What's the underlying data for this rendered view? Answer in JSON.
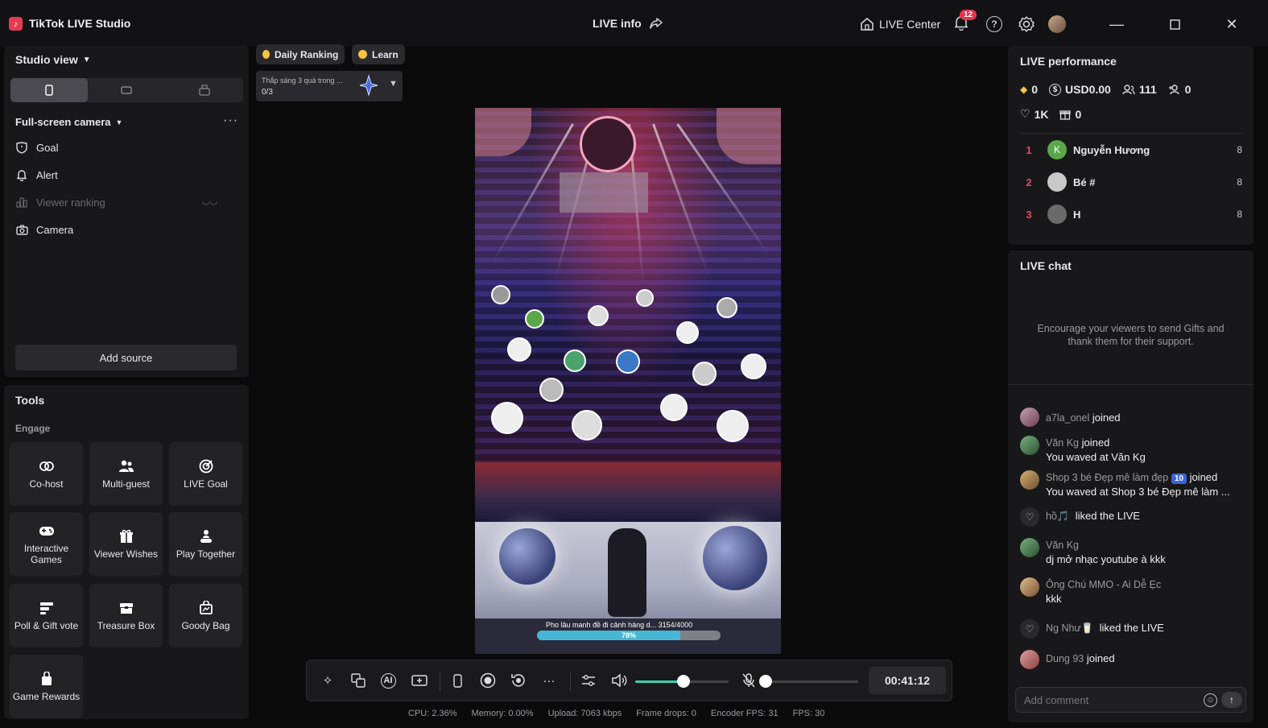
{
  "app": {
    "title": "TikTok LIVE Studio",
    "live_info": "LIVE info",
    "live_center": "LIVE Center",
    "notifications": "12"
  },
  "left": {
    "studio_view": "Studio view",
    "scene": "Full-screen camera",
    "sources": [
      {
        "label": "Goal",
        "icon": "goal-shield-icon",
        "enabled": true
      },
      {
        "label": "Alert",
        "icon": "bell-icon",
        "enabled": true
      },
      {
        "label": "Viewer ranking",
        "icon": "ranking-icon",
        "enabled": false
      },
      {
        "label": "Camera",
        "icon": "camera-icon",
        "enabled": true
      }
    ],
    "add_source": "Add source"
  },
  "tools": {
    "title": "Tools",
    "section": "Engage",
    "items": [
      {
        "label": "Co-host",
        "icon": "link-icon"
      },
      {
        "label": "Multi-guest",
        "icon": "users-icon"
      },
      {
        "label": "LIVE Goal",
        "icon": "target-icon"
      },
      {
        "label": "Interactive Games",
        "icon": "gamepad-icon"
      },
      {
        "label": "Viewer Wishes",
        "icon": "gift-wish-icon"
      },
      {
        "label": "Play Together",
        "icon": "play-together-icon"
      },
      {
        "label": "Poll & Gift vote",
        "icon": "poll-icon"
      },
      {
        "label": "Treasure Box",
        "icon": "treasure-box-icon"
      },
      {
        "label": "Goody Bag",
        "icon": "goody-bag-icon"
      },
      {
        "label": "Game Rewards",
        "icon": "game-rewards-icon"
      }
    ]
  },
  "center": {
    "daily_ranking": "Daily Ranking",
    "learn": "Learn",
    "task_text": "Thắp sáng 3 quà trong ...",
    "task_progress": "0/3",
    "goal_bar_text": "Pho lâu manh đề đi cảnh hàng d... 3154/4000",
    "goal_bar_percent": "78%",
    "goal_bar_fill": 0.78,
    "timer": "00:41:12",
    "volume_level": 0.52,
    "mic_level": 0.0
  },
  "stats": {
    "cpu": "CPU:  2.36%",
    "memory": "Memory:  0.00%",
    "upload": "Upload:  7063 kbps",
    "frame_drops": "Frame drops:  0",
    "encoder_fps": "Encoder FPS:  31",
    "fps": "FPS:  30"
  },
  "performance": {
    "title": "LIVE performance",
    "diamonds": "0",
    "usd": "USD0.00",
    "viewers": "111",
    "new_followers": "0",
    "likes": "1K",
    "gifts": "0",
    "ranking": [
      {
        "rank": "1",
        "name": "Nguyễn Hương",
        "score": "8",
        "initial": "K",
        "color": "#5aa84a"
      },
      {
        "rank": "2",
        "name": "Bé #",
        "score": "8",
        "initial": "",
        "color": "#c8c8c8"
      },
      {
        "rank": "3",
        "name": "H",
        "score": "8",
        "initial": "",
        "color": "#6a6a6a"
      }
    ]
  },
  "chat": {
    "title": "LIVE chat",
    "encourage": "Encourage your viewers to send Gifts and thank them for their support.",
    "messages": [
      {
        "user": "a7la_onel",
        "action": "joined",
        "extra": ""
      },
      {
        "user": "Văn Kg",
        "action": "joined",
        "extra": "You waved at Văn Kg"
      },
      {
        "user": "Shop 3 bé Đẹp mê làm đẹp",
        "level": "10",
        "action": "joined",
        "extra": "You waved at Shop 3 bé Đẹp mê làm ..."
      },
      {
        "user": "hồ🎵",
        "action": "liked the LIVE",
        "extra": ""
      },
      {
        "user": "Văn Kg",
        "action": "",
        "extra": "dj mở nhạc youtube à kkk"
      },
      {
        "user": "Ông Chú MMO - Ai Dễ Ẹc",
        "action": "",
        "extra": "kkk"
      },
      {
        "user": "Ng Như🥛",
        "action": "liked the LIVE",
        "extra": ""
      },
      {
        "user": "Dung 93",
        "action": "joined",
        "extra": ""
      }
    ],
    "placeholder": "Add comment"
  }
}
